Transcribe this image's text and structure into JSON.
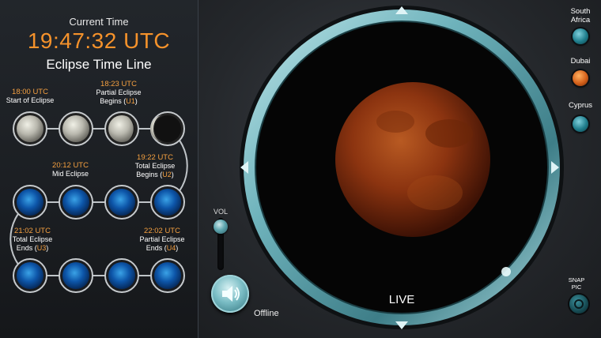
{
  "header": {
    "current_time_label": "Current Time",
    "current_time_value": "19:47:32 UTC",
    "timeline_title": "Eclipse Time Line"
  },
  "events": {
    "start": {
      "time": "18:00 UTC",
      "desc": "Start of Eclipse"
    },
    "partial_begins": {
      "time": "18:23 UTC",
      "desc1": "Partial Eclipse",
      "desc2": "Begins (",
      "code": "U1",
      "close": ")"
    },
    "mid": {
      "time": "20:12 UTC",
      "desc": "Mid Eclipse"
    },
    "total_begins": {
      "time": "19:22 UTC",
      "desc1": "Total Eclipse",
      "desc2": "Begins (",
      "code": "U2",
      "close": ")"
    },
    "total_ends": {
      "time": "21:02 UTC",
      "desc1": "Total Eclipse",
      "desc2": "Ends (",
      "code": "U3",
      "close": ")"
    },
    "partial_ends": {
      "time": "22:02 UTC",
      "desc1": "Partial Eclipse",
      "desc2": "Ends (",
      "code": "U4",
      "close": ")"
    }
  },
  "timeline_nodes": [
    {
      "phase": "moon-full"
    },
    {
      "phase": "moon-full"
    },
    {
      "phase": "moon-partial"
    },
    {
      "phase": "moon-crescent"
    },
    {
      "phase": "pending"
    },
    {
      "phase": "pending"
    },
    {
      "phase": "pending"
    },
    {
      "phase": "pending"
    },
    {
      "phase": "pending"
    },
    {
      "phase": "pending"
    },
    {
      "phase": "pending"
    },
    {
      "phase": "pending"
    }
  ],
  "controls": {
    "vol_label": "VOL",
    "volume_level": 0.9,
    "offline_label": "Offline",
    "snap_label_1": "SNAP",
    "snap_label_2": "PIC"
  },
  "viewer": {
    "live_label": "LIVE"
  },
  "locations": [
    {
      "name1": "South",
      "name2": "Africa",
      "color": "#1f7d8c",
      "active": false
    },
    {
      "name1": "Dubai",
      "name2": "",
      "color": "#d4601a",
      "active": true
    },
    {
      "name1": "Cyprus",
      "name2": "",
      "color": "#1f7d8c",
      "active": false
    }
  ],
  "colors": {
    "accent_orange": "#f5922b",
    "ring_teal": "#5fa7b0",
    "moon_red": "#9c3a12"
  }
}
